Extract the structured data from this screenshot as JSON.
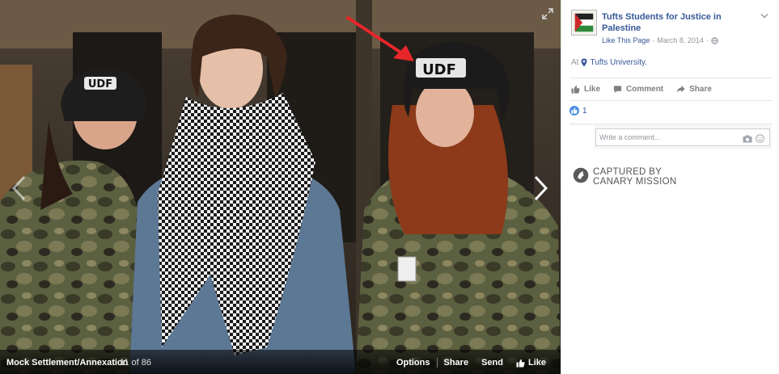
{
  "photo": {
    "helmet_label": "UDF"
  },
  "bottom_bar": {
    "album_title": "Mock Settlement/Annexation",
    "counter": "11 of 86",
    "options": "Options",
    "share": "Share",
    "send": "Send",
    "like": "Like"
  },
  "post": {
    "page_name": "Tufts Students for Justice in Palestine",
    "like_page": "Like This Page",
    "separator": "·",
    "date": "March 8, 2014",
    "separator2": "·",
    "location_prefix": "At",
    "location": "Tufts University."
  },
  "ufi": {
    "like": "Like",
    "comment": "Comment",
    "share": "Share"
  },
  "reactions": {
    "count": "1"
  },
  "comment": {
    "placeholder": "Write a comment..."
  },
  "watermark": {
    "line1": "CAPTURED BY",
    "line2": "CANARY MISSION"
  },
  "colors": {
    "link": "#365899",
    "meta": "#90949c",
    "annotation_arrow": "#e8262a"
  }
}
